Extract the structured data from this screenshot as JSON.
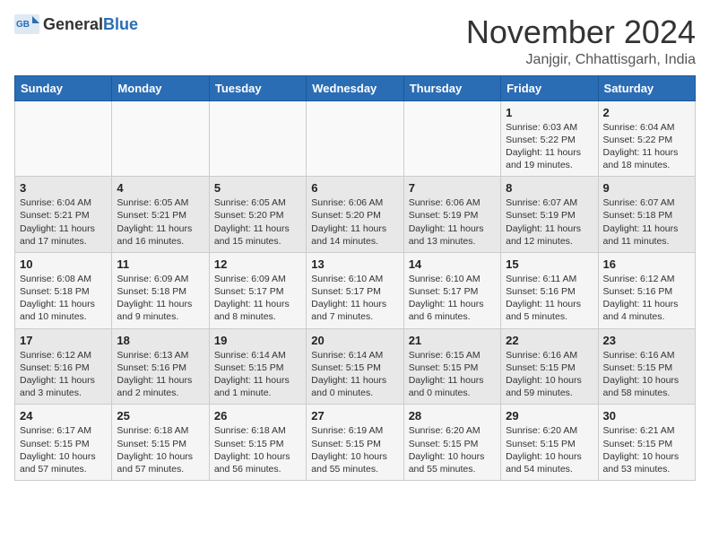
{
  "header": {
    "logo_general": "General",
    "logo_blue": "Blue",
    "month_title": "November 2024",
    "location": "Janjgir, Chhattisgarh, India"
  },
  "weekdays": [
    "Sunday",
    "Monday",
    "Tuesday",
    "Wednesday",
    "Thursday",
    "Friday",
    "Saturday"
  ],
  "weeks": [
    [
      {
        "day": "",
        "info": ""
      },
      {
        "day": "",
        "info": ""
      },
      {
        "day": "",
        "info": ""
      },
      {
        "day": "",
        "info": ""
      },
      {
        "day": "",
        "info": ""
      },
      {
        "day": "1",
        "info": "Sunrise: 6:03 AM\nSunset: 5:22 PM\nDaylight: 11 hours and 19 minutes."
      },
      {
        "day": "2",
        "info": "Sunrise: 6:04 AM\nSunset: 5:22 PM\nDaylight: 11 hours and 18 minutes."
      }
    ],
    [
      {
        "day": "3",
        "info": "Sunrise: 6:04 AM\nSunset: 5:21 PM\nDaylight: 11 hours and 17 minutes."
      },
      {
        "day": "4",
        "info": "Sunrise: 6:05 AM\nSunset: 5:21 PM\nDaylight: 11 hours and 16 minutes."
      },
      {
        "day": "5",
        "info": "Sunrise: 6:05 AM\nSunset: 5:20 PM\nDaylight: 11 hours and 15 minutes."
      },
      {
        "day": "6",
        "info": "Sunrise: 6:06 AM\nSunset: 5:20 PM\nDaylight: 11 hours and 14 minutes."
      },
      {
        "day": "7",
        "info": "Sunrise: 6:06 AM\nSunset: 5:19 PM\nDaylight: 11 hours and 13 minutes."
      },
      {
        "day": "8",
        "info": "Sunrise: 6:07 AM\nSunset: 5:19 PM\nDaylight: 11 hours and 12 minutes."
      },
      {
        "day": "9",
        "info": "Sunrise: 6:07 AM\nSunset: 5:18 PM\nDaylight: 11 hours and 11 minutes."
      }
    ],
    [
      {
        "day": "10",
        "info": "Sunrise: 6:08 AM\nSunset: 5:18 PM\nDaylight: 11 hours and 10 minutes."
      },
      {
        "day": "11",
        "info": "Sunrise: 6:09 AM\nSunset: 5:18 PM\nDaylight: 11 hours and 9 minutes."
      },
      {
        "day": "12",
        "info": "Sunrise: 6:09 AM\nSunset: 5:17 PM\nDaylight: 11 hours and 8 minutes."
      },
      {
        "day": "13",
        "info": "Sunrise: 6:10 AM\nSunset: 5:17 PM\nDaylight: 11 hours and 7 minutes."
      },
      {
        "day": "14",
        "info": "Sunrise: 6:10 AM\nSunset: 5:17 PM\nDaylight: 11 hours and 6 minutes."
      },
      {
        "day": "15",
        "info": "Sunrise: 6:11 AM\nSunset: 5:16 PM\nDaylight: 11 hours and 5 minutes."
      },
      {
        "day": "16",
        "info": "Sunrise: 6:12 AM\nSunset: 5:16 PM\nDaylight: 11 hours and 4 minutes."
      }
    ],
    [
      {
        "day": "17",
        "info": "Sunrise: 6:12 AM\nSunset: 5:16 PM\nDaylight: 11 hours and 3 minutes."
      },
      {
        "day": "18",
        "info": "Sunrise: 6:13 AM\nSunset: 5:16 PM\nDaylight: 11 hours and 2 minutes."
      },
      {
        "day": "19",
        "info": "Sunrise: 6:14 AM\nSunset: 5:15 PM\nDaylight: 11 hours and 1 minute."
      },
      {
        "day": "20",
        "info": "Sunrise: 6:14 AM\nSunset: 5:15 PM\nDaylight: 11 hours and 0 minutes."
      },
      {
        "day": "21",
        "info": "Sunrise: 6:15 AM\nSunset: 5:15 PM\nDaylight: 11 hours and 0 minutes."
      },
      {
        "day": "22",
        "info": "Sunrise: 6:16 AM\nSunset: 5:15 PM\nDaylight: 10 hours and 59 minutes."
      },
      {
        "day": "23",
        "info": "Sunrise: 6:16 AM\nSunset: 5:15 PM\nDaylight: 10 hours and 58 minutes."
      }
    ],
    [
      {
        "day": "24",
        "info": "Sunrise: 6:17 AM\nSunset: 5:15 PM\nDaylight: 10 hours and 57 minutes."
      },
      {
        "day": "25",
        "info": "Sunrise: 6:18 AM\nSunset: 5:15 PM\nDaylight: 10 hours and 57 minutes."
      },
      {
        "day": "26",
        "info": "Sunrise: 6:18 AM\nSunset: 5:15 PM\nDaylight: 10 hours and 56 minutes."
      },
      {
        "day": "27",
        "info": "Sunrise: 6:19 AM\nSunset: 5:15 PM\nDaylight: 10 hours and 55 minutes."
      },
      {
        "day": "28",
        "info": "Sunrise: 6:20 AM\nSunset: 5:15 PM\nDaylight: 10 hours and 55 minutes."
      },
      {
        "day": "29",
        "info": "Sunrise: 6:20 AM\nSunset: 5:15 PM\nDaylight: 10 hours and 54 minutes."
      },
      {
        "day": "30",
        "info": "Sunrise: 6:21 AM\nSunset: 5:15 PM\nDaylight: 10 hours and 53 minutes."
      }
    ]
  ]
}
